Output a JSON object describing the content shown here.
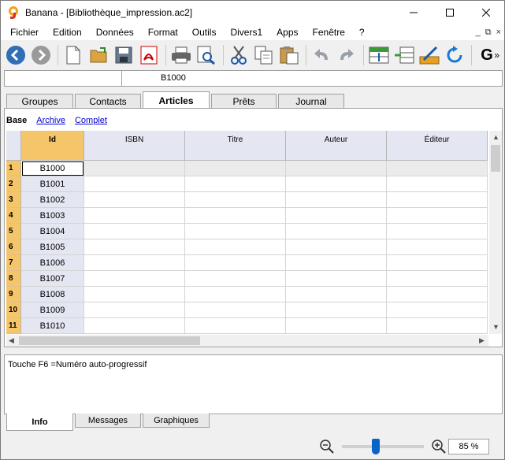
{
  "window": {
    "title": "Banana - [Bibliothèque_impression.ac2]"
  },
  "menu": [
    "Fichier",
    "Edition",
    "Données",
    "Format",
    "Outils",
    "Divers1",
    "Apps",
    "Fenêtre",
    "?"
  ],
  "mdi": {
    "minimize": "_",
    "restore": "⧉",
    "close": "×"
  },
  "toolbar": {
    "icons": [
      "back-icon",
      "forward-icon",
      "new-file-icon",
      "open-folder-icon",
      "save-icon",
      "pdf-icon",
      "print-icon",
      "print-preview-icon",
      "cut-icon",
      "copy-icon",
      "paste-icon",
      "undo-icon",
      "redo-icon",
      "insert-rows-icon",
      "move-rows-icon",
      "edit-cell-icon",
      "refresh-icon",
      "g-icon"
    ],
    "g_label": "G",
    "more": "»"
  },
  "cellbar": {
    "value": "B1000"
  },
  "tabs": [
    "Groupes",
    "Contacts",
    "Articles",
    "Prêts",
    "Journal"
  ],
  "active_tab": "Articles",
  "views": {
    "base": "Base",
    "archive": "Archive",
    "complet": "Complet"
  },
  "table": {
    "columns": [
      "Id",
      "ISBN",
      "Titre",
      "Auteur",
      "Éditeur"
    ],
    "row_numbers": [
      "1",
      "2",
      "3",
      "4",
      "5",
      "6",
      "7",
      "8",
      "9",
      "10",
      "11"
    ],
    "ids": [
      "B1000",
      "B1001",
      "B1002",
      "B1003",
      "B1004",
      "B1005",
      "B1006",
      "B1007",
      "B1008",
      "B1009",
      "B1010"
    ]
  },
  "info": {
    "text": "Touche F6 =Numéro auto-progressif"
  },
  "bottom_tabs": [
    "Info",
    "Messages",
    "Graphiques"
  ],
  "zoom": {
    "value": "85 %",
    "level": 0.4
  }
}
